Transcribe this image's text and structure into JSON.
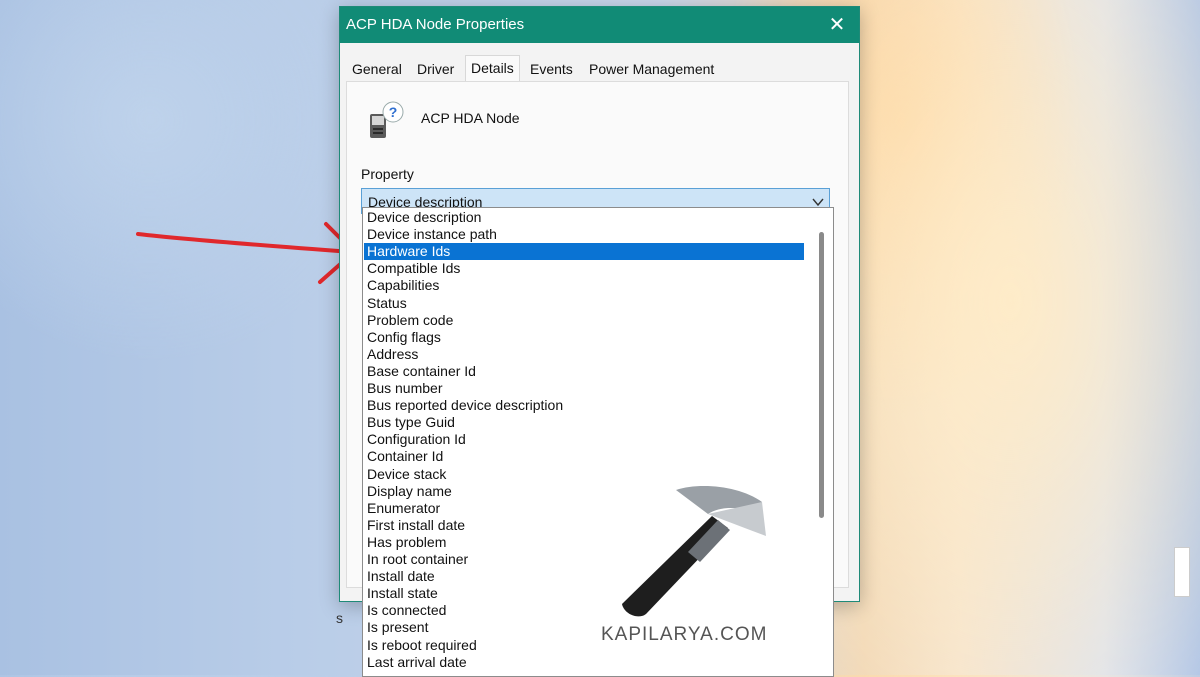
{
  "window": {
    "title": "ACP HDA Node Properties",
    "close_glyph": "✕"
  },
  "tabs": [
    {
      "label": "General"
    },
    {
      "label": "Driver"
    },
    {
      "label": "Details",
      "active": true
    },
    {
      "label": "Events"
    },
    {
      "label": "Power Management"
    }
  ],
  "device": {
    "name": "ACP HDA Node",
    "icon": "unknown-device-icon"
  },
  "property": {
    "label": "Property",
    "selected_value": "Device description"
  },
  "dropdown": {
    "items": [
      "Device description",
      "Device instance path",
      "Hardware Ids",
      "Compatible Ids",
      "Capabilities",
      "Status",
      "Problem code",
      "Config flags",
      "Address",
      "Base container Id",
      "Bus number",
      "Bus reported device description",
      "Bus type Guid",
      "Configuration Id",
      "Container Id",
      "Device stack",
      "Display name",
      "Enumerator",
      "First install date",
      "Has problem",
      "In root container",
      "Install date",
      "Install state",
      "Is connected",
      "Is present",
      "Is reboot required",
      "Last arrival date"
    ],
    "selected_item": "Hardware Ids"
  },
  "watermark": {
    "text": "KAPILARYA.COM",
    "icon": "hammer-icon"
  },
  "colors": {
    "titlebar": "#118b76",
    "selection": "#0a73d3",
    "annotation_arrow": "#e0282c"
  },
  "side_fragment": "s"
}
